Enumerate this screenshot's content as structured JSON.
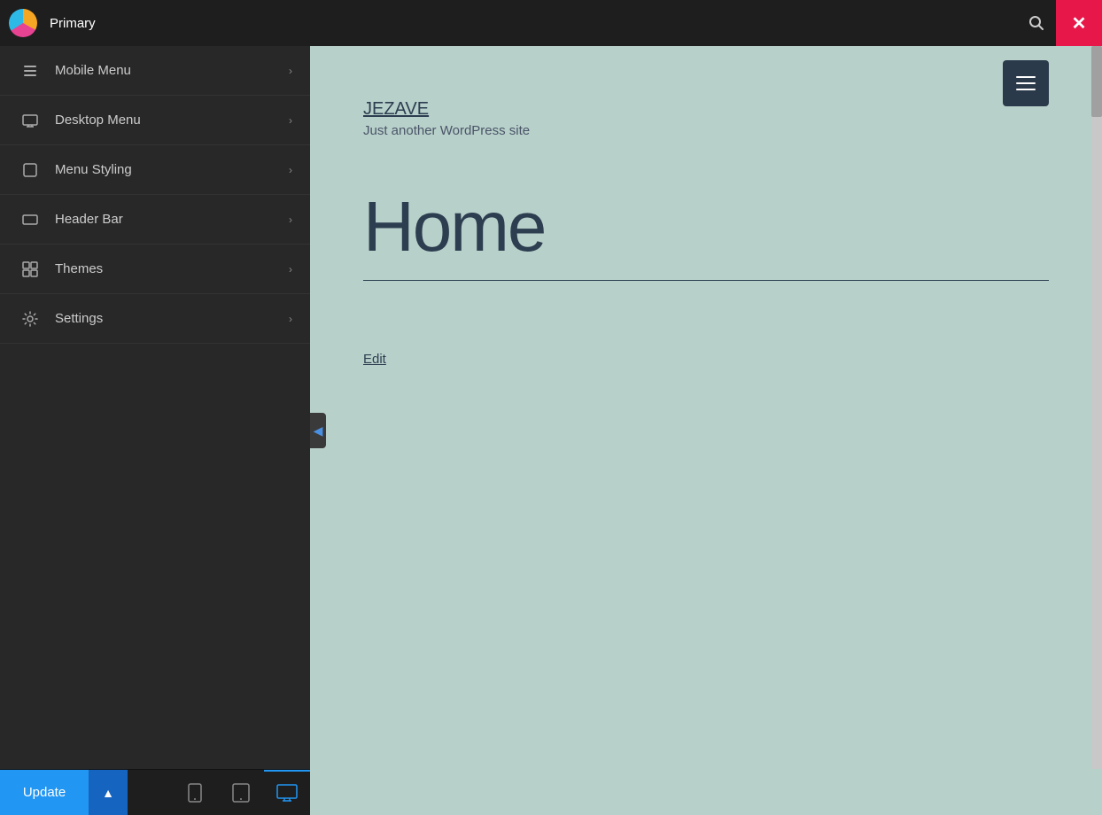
{
  "topbar": {
    "title": "Primary",
    "search_icon": "🔍",
    "close_icon": "✕"
  },
  "sidebar": {
    "items": [
      {
        "id": "mobile-menu",
        "label": "Mobile Menu",
        "icon": "☰"
      },
      {
        "id": "desktop-menu",
        "label": "Desktop Menu",
        "icon": "🖥"
      },
      {
        "id": "menu-styling",
        "label": "Menu Styling",
        "icon": "⬜"
      },
      {
        "id": "header-bar",
        "label": "Header Bar",
        "icon": "▭"
      },
      {
        "id": "themes",
        "label": "Themes",
        "icon": "⊞"
      },
      {
        "id": "settings",
        "label": "Settings",
        "icon": "⚙"
      }
    ]
  },
  "bottom_toolbar": {
    "update_label": "Update",
    "devices": [
      "mobile",
      "tablet",
      "desktop"
    ]
  },
  "preview": {
    "site_title": "JEZAVE",
    "site_tagline": "Just another WordPress site",
    "hero_title": "Home",
    "edit_label": "Edit"
  }
}
